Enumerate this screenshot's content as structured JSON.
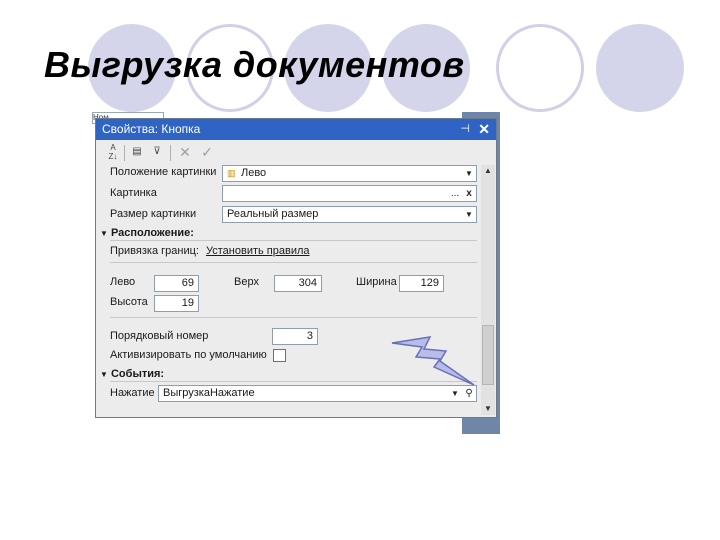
{
  "slide": {
    "title": "Выгрузка документов"
  },
  "window": {
    "title": "Свойства: Кнопка",
    "behind_label": "Ном",
    "toolbar": [
      "sort-az-icon",
      "categories-icon",
      "filter-icon",
      "clear-icon",
      "check-icon"
    ],
    "rows": {
      "picture_position": {
        "label": "Положение картинки",
        "value": "Лево"
      },
      "picture": {
        "label": "Картинка",
        "value": ""
      },
      "picture_size": {
        "label": "Размер картинки",
        "value": "Реальный размер"
      },
      "layout_section": "Расположение:",
      "anchor": {
        "label": "Привязка границ:",
        "link": "Установить правила"
      },
      "left": {
        "label": "Лево",
        "value": "69"
      },
      "top": {
        "label": "Верх",
        "value": "304"
      },
      "width": {
        "label": "Ширина",
        "value": "129"
      },
      "height": {
        "label": "Высота",
        "value": "19"
      },
      "order": {
        "label": "Порядковый номер",
        "value": "3"
      },
      "default_active": {
        "label": "Активизировать по умолчанию",
        "checked": false
      },
      "events_section": "События:",
      "click": {
        "label": "Нажатие",
        "value": "ВыгрузкаНажатие"
      }
    }
  }
}
